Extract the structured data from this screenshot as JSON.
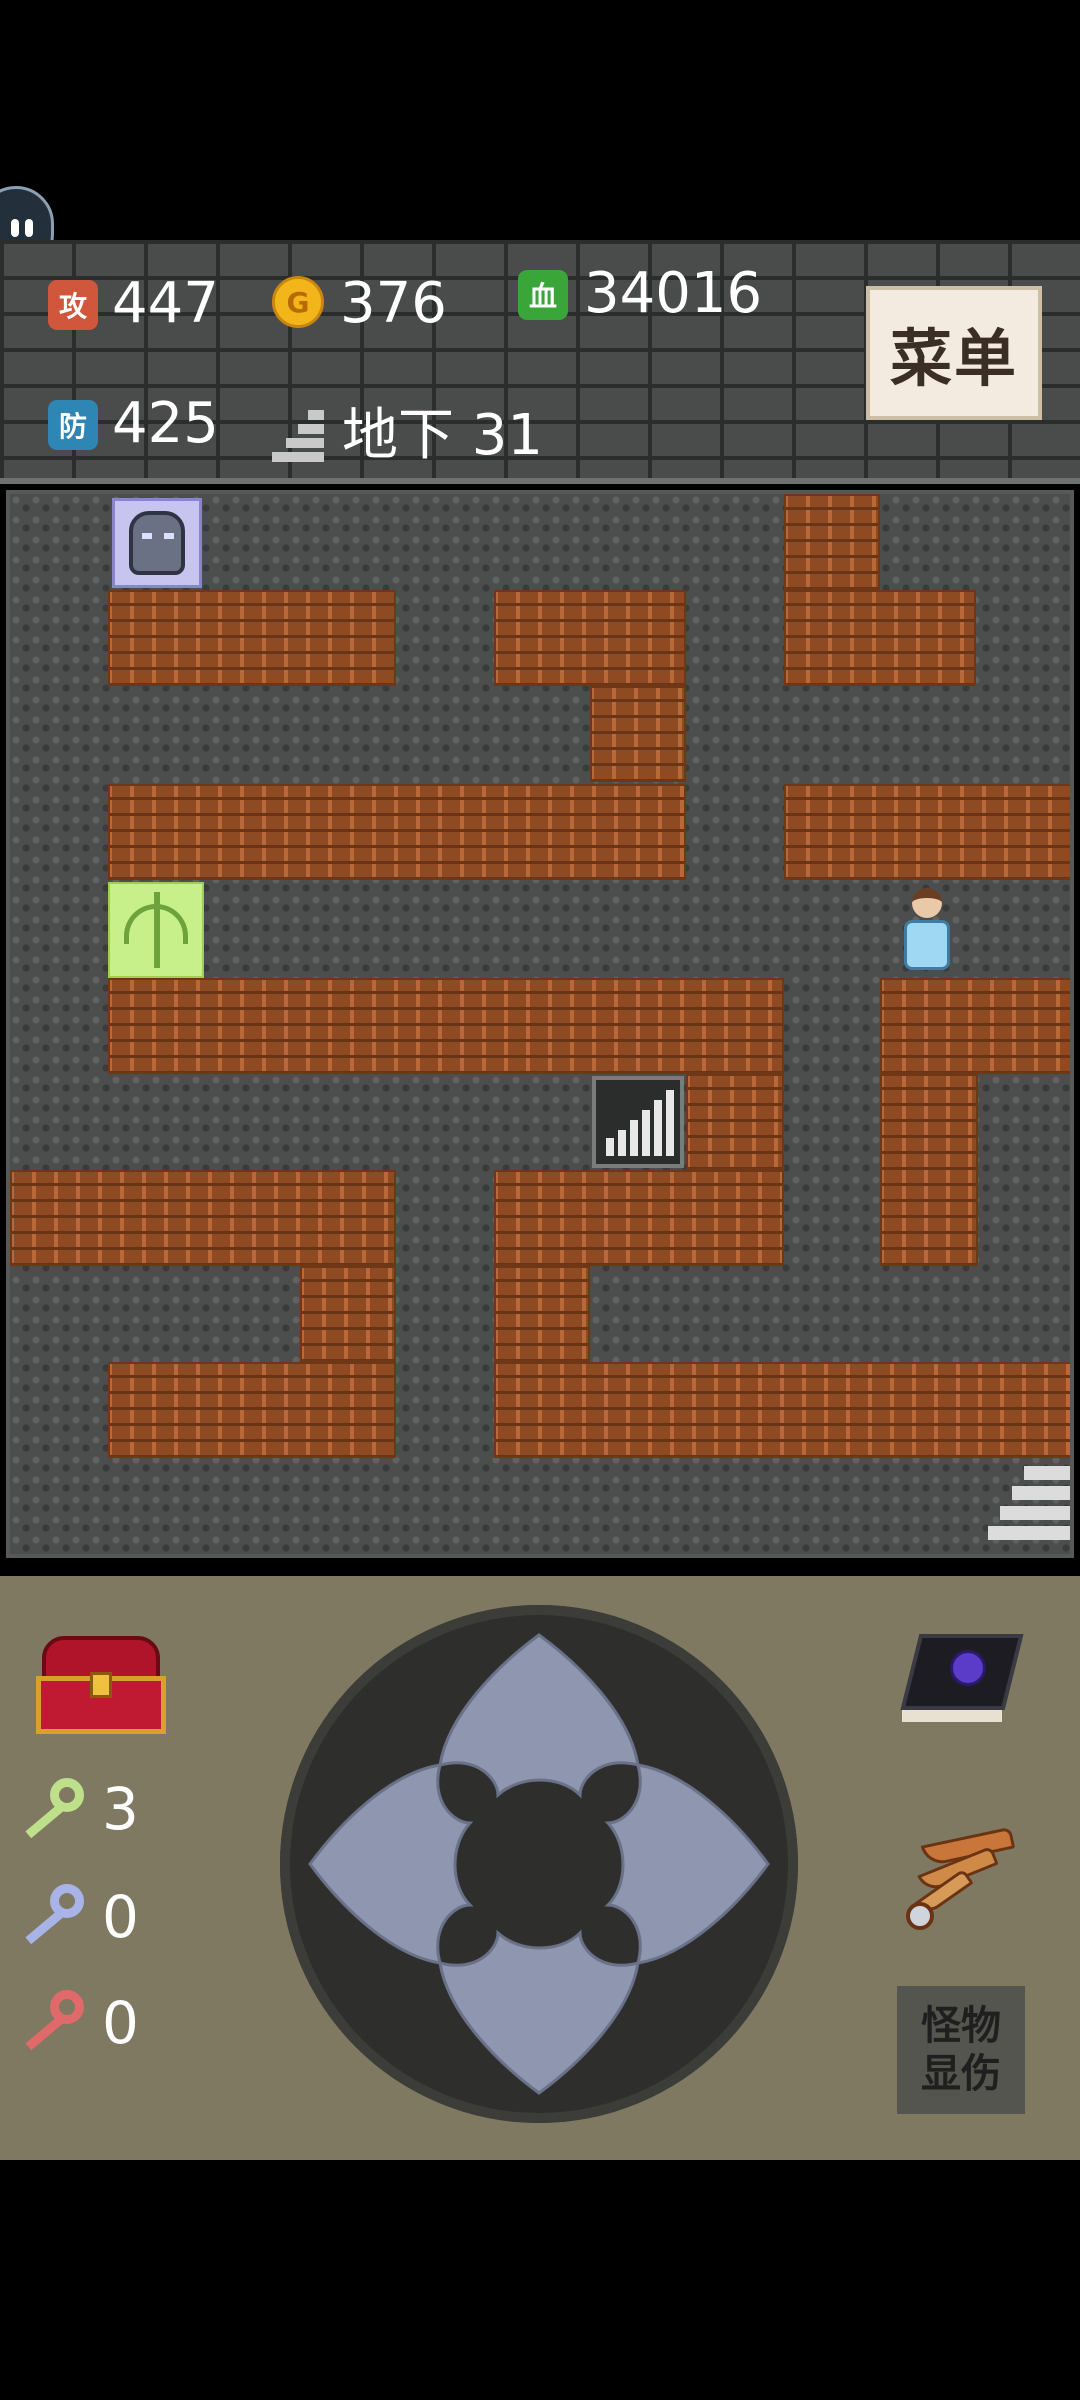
{
  "hud": {
    "attack_label": "攻",
    "attack": "447",
    "defense_label": "防",
    "defense": "425",
    "gold_icon_text": "G",
    "gold": "376",
    "hp_label": "血",
    "hp": "34016",
    "floor": "地下 31",
    "menu_button": "菜单"
  },
  "board": {
    "grid_size": 11,
    "wall_color": "#8e4a22",
    "floor_color": "#4c4d4d",
    "entities": [
      "stone-golem",
      "green-vine-monster",
      "hero",
      "stairs-down",
      "stairs-up"
    ]
  },
  "inventory": {
    "keys": [
      {
        "color": "yellow",
        "count": "3"
      },
      {
        "color": "blue",
        "count": "0"
      },
      {
        "color": "red",
        "count": "0"
      }
    ],
    "items": [
      "treasure-chest-icon",
      "monster-manual-book-icon",
      "flying-wing-icon"
    ]
  },
  "controls": {
    "monster_damage_line1": "怪物",
    "monster_damage_line2": "显伤"
  }
}
